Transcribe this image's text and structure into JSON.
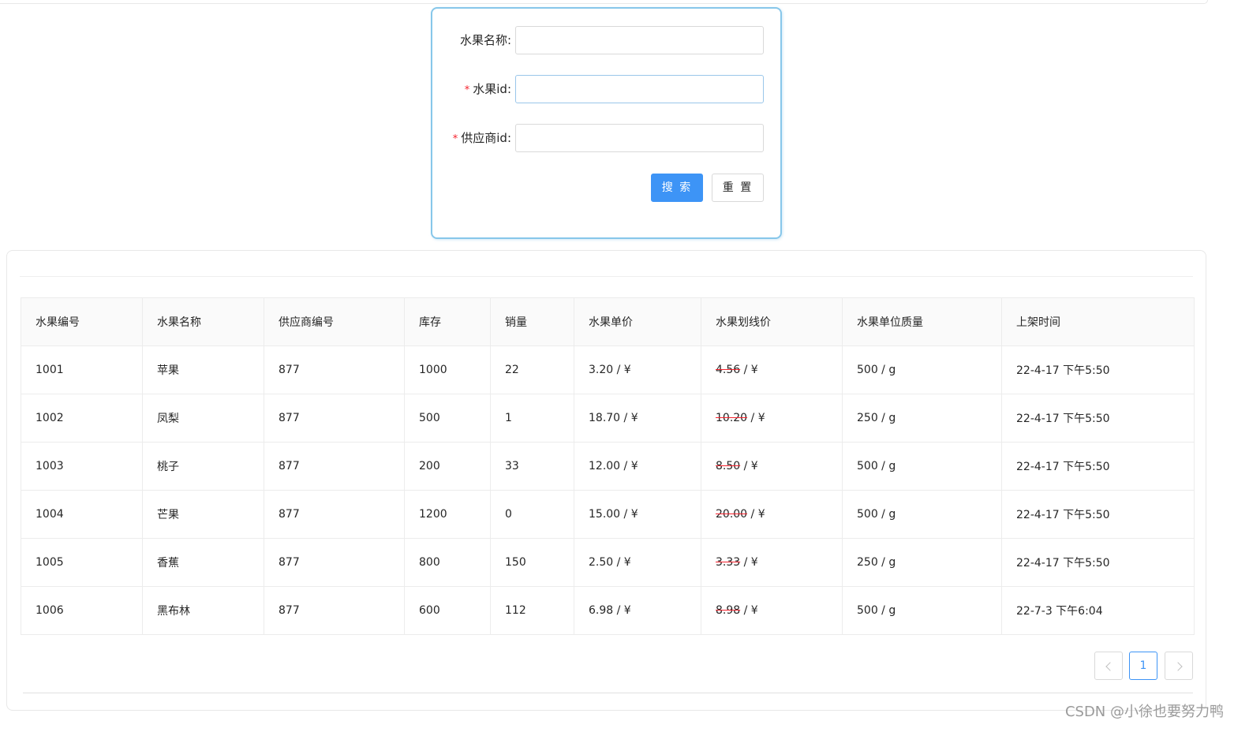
{
  "search_form": {
    "fields": [
      {
        "label": "水果名称:",
        "required": false,
        "value": "",
        "placeholder": ""
      },
      {
        "label": "水果id:",
        "required": true,
        "value": "",
        "placeholder": ""
      },
      {
        "label": "供应商id:",
        "required": true,
        "value": "",
        "placeholder": ""
      }
    ],
    "required_mark": "*",
    "search_label": "搜 索",
    "reset_label": "重 置"
  },
  "table": {
    "columns": [
      "水果编号",
      "水果名称",
      "供应商编号",
      "库存",
      "销量",
      "水果单价",
      "水果划线价",
      "水果单位质量",
      "上架时间"
    ],
    "rows": [
      {
        "id": "1001",
        "name": "苹果",
        "supplier": "877",
        "stock": "1000",
        "sales": "22",
        "price": "3.20",
        "price_unit": " / ¥",
        "strike_price": "4.56",
        "strike_unit": " / ¥",
        "weight": "500 / g",
        "listed": "22-4-17 下午5:50"
      },
      {
        "id": "1002",
        "name": "凤梨",
        "supplier": "877",
        "stock": "500",
        "sales": "1",
        "price": "18.70",
        "price_unit": " / ¥",
        "strike_price": "10.20",
        "strike_unit": " / ¥",
        "weight": "250 / g",
        "listed": "22-4-17 下午5:50"
      },
      {
        "id": "1003",
        "name": "桃子",
        "supplier": "877",
        "stock": "200",
        "sales": "33",
        "price": "12.00",
        "price_unit": " / ¥",
        "strike_price": "8.50",
        "strike_unit": " / ¥",
        "weight": "500 / g",
        "listed": "22-4-17 下午5:50"
      },
      {
        "id": "1004",
        "name": "芒果",
        "supplier": "877",
        "stock": "1200",
        "sales": "0",
        "price": "15.00",
        "price_unit": " / ¥",
        "strike_price": "20.00",
        "strike_unit": " / ¥",
        "weight": "500 / g",
        "listed": "22-4-17 下午5:50"
      },
      {
        "id": "1005",
        "name": "香蕉",
        "supplier": "877",
        "stock": "800",
        "sales": "150",
        "price": "2.50",
        "price_unit": " / ¥",
        "strike_price": "3.33",
        "strike_unit": " / ¥",
        "weight": "250 / g",
        "listed": "22-4-17 下午5:50"
      },
      {
        "id": "1006",
        "name": "黑布林",
        "supplier": "877",
        "stock": "600",
        "sales": "112",
        "price": "6.98",
        "price_unit": " / ¥",
        "strike_price": "8.98",
        "strike_unit": " / ¥",
        "weight": "500 / g",
        "listed": "22-7-3 下午6:04"
      }
    ]
  },
  "pagination": {
    "current_page": "1",
    "prev_icon": "chevron-left-icon",
    "next_icon": "chevron-right-icon"
  },
  "watermark": "CSDN @小徐也要努力鸭",
  "colors": {
    "primary": "#3d94f6",
    "card_border": "#87c7ea",
    "required": "#f5222d",
    "strike": "#f5222d"
  }
}
